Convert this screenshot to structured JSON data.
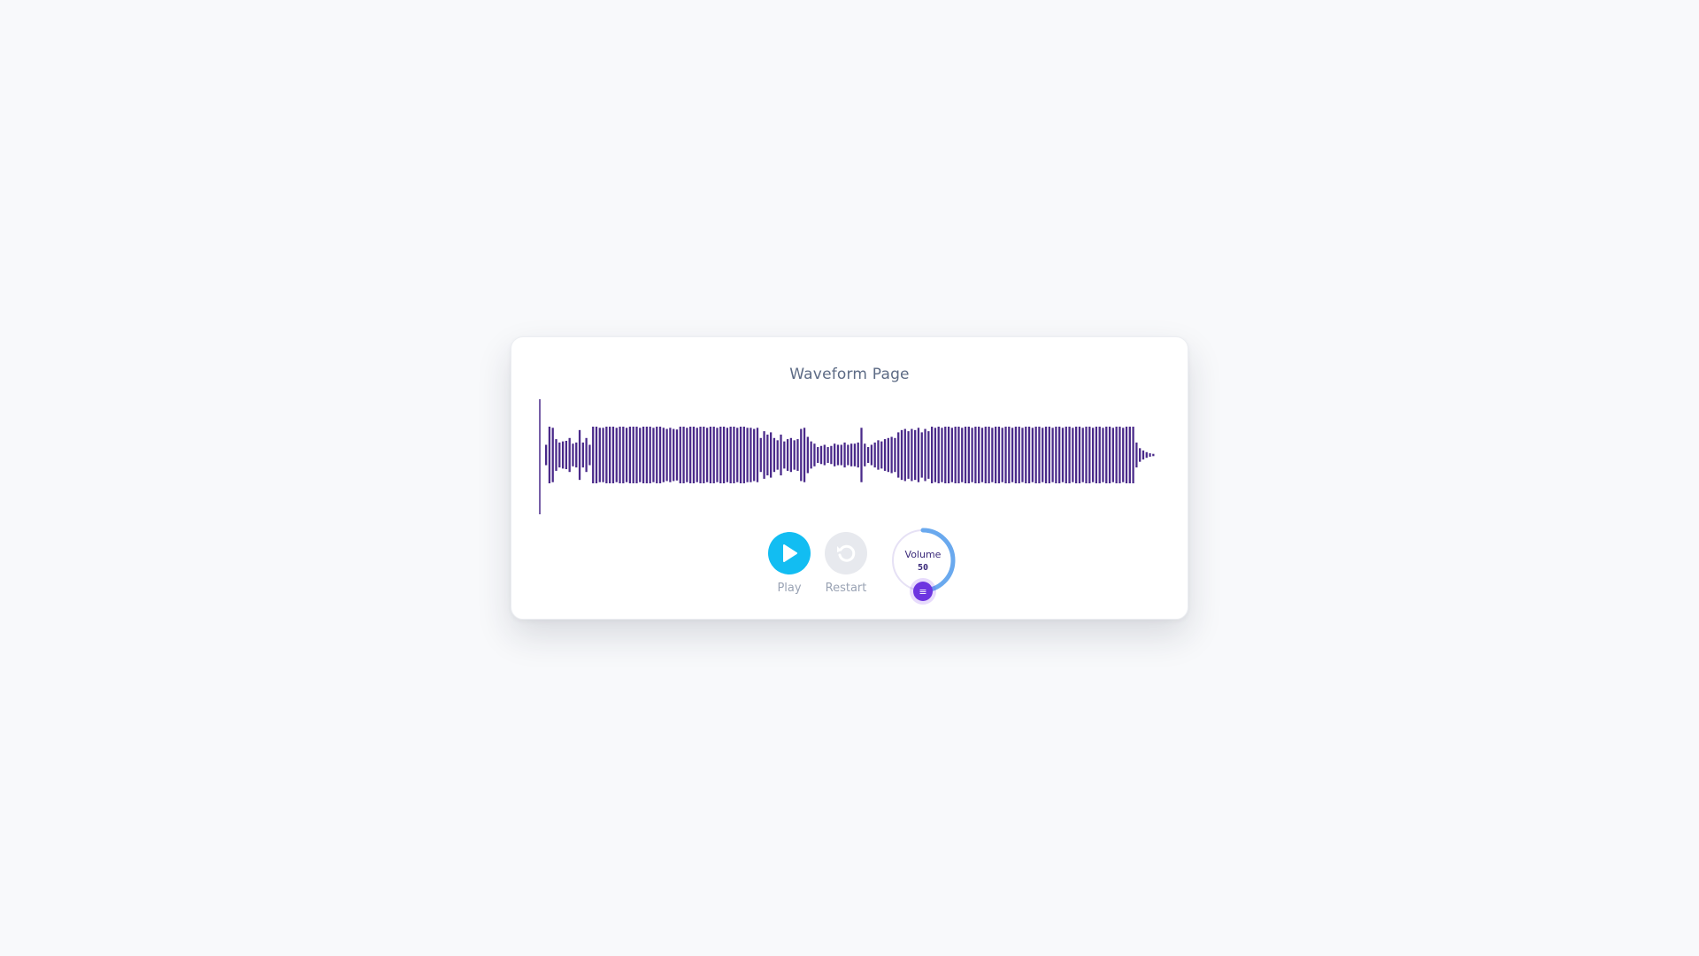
{
  "page": {
    "title": "Waveform Page"
  },
  "waveform": {
    "color": "#4a2a8a",
    "progress": 0,
    "amplitudes": [
      0.18,
      0.5,
      0.48,
      0.28,
      0.22,
      0.24,
      0.25,
      0.3,
      0.2,
      0.22,
      0.44,
      0.22,
      0.3,
      0.18,
      0.5,
      0.5,
      0.48,
      0.48,
      0.5,
      0.5,
      0.5,
      0.48,
      0.5,
      0.5,
      0.48,
      0.5,
      0.5,
      0.5,
      0.48,
      0.5,
      0.5,
      0.5,
      0.48,
      0.5,
      0.5,
      0.48,
      0.46,
      0.48,
      0.46,
      0.45,
      0.5,
      0.5,
      0.48,
      0.5,
      0.5,
      0.48,
      0.5,
      0.5,
      0.48,
      0.5,
      0.5,
      0.48,
      0.5,
      0.5,
      0.48,
      0.5,
      0.5,
      0.48,
      0.5,
      0.5,
      0.48,
      0.48,
      0.46,
      0.48,
      0.3,
      0.42,
      0.36,
      0.4,
      0.3,
      0.26,
      0.36,
      0.24,
      0.28,
      0.3,
      0.26,
      0.28,
      0.46,
      0.48,
      0.32,
      0.24,
      0.2,
      0.14,
      0.16,
      0.18,
      0.14,
      0.16,
      0.2,
      0.18,
      0.18,
      0.22,
      0.18,
      0.2,
      0.2,
      0.22,
      0.48,
      0.2,
      0.14,
      0.18,
      0.22,
      0.26,
      0.24,
      0.28,
      0.3,
      0.32,
      0.3,
      0.4,
      0.44,
      0.46,
      0.42,
      0.46,
      0.44,
      0.48,
      0.4,
      0.46,
      0.42,
      0.5,
      0.48,
      0.5,
      0.48,
      0.5,
      0.5,
      0.48,
      0.5,
      0.5,
      0.48,
      0.5,
      0.5,
      0.48,
      0.5,
      0.5,
      0.48,
      0.5,
      0.5,
      0.48,
      0.5,
      0.5,
      0.48,
      0.5,
      0.5,
      0.48,
      0.5,
      0.5,
      0.48,
      0.5,
      0.5,
      0.48,
      0.5,
      0.5,
      0.48,
      0.5,
      0.5,
      0.48,
      0.5,
      0.5,
      0.48,
      0.5,
      0.5,
      0.48,
      0.5,
      0.5,
      0.48,
      0.5,
      0.5,
      0.48,
      0.5,
      0.5,
      0.48,
      0.5,
      0.5,
      0.48,
      0.5,
      0.5,
      0.48,
      0.5,
      0.5,
      0.5,
      0.22,
      0.12,
      0.08,
      0.05,
      0.03,
      0.02
    ]
  },
  "controls": {
    "play": {
      "label": "Play",
      "icon": "play-icon",
      "color": "#12bdf2"
    },
    "restart": {
      "label": "Restart",
      "icon": "restart-icon",
      "color": "#e7e9ee"
    },
    "volume": {
      "label": "Volume",
      "value": "50",
      "level": 0.5,
      "knob_glyph": "≡",
      "ring_color": "#6aa9ee",
      "knob_color": "#6d35e0"
    }
  }
}
